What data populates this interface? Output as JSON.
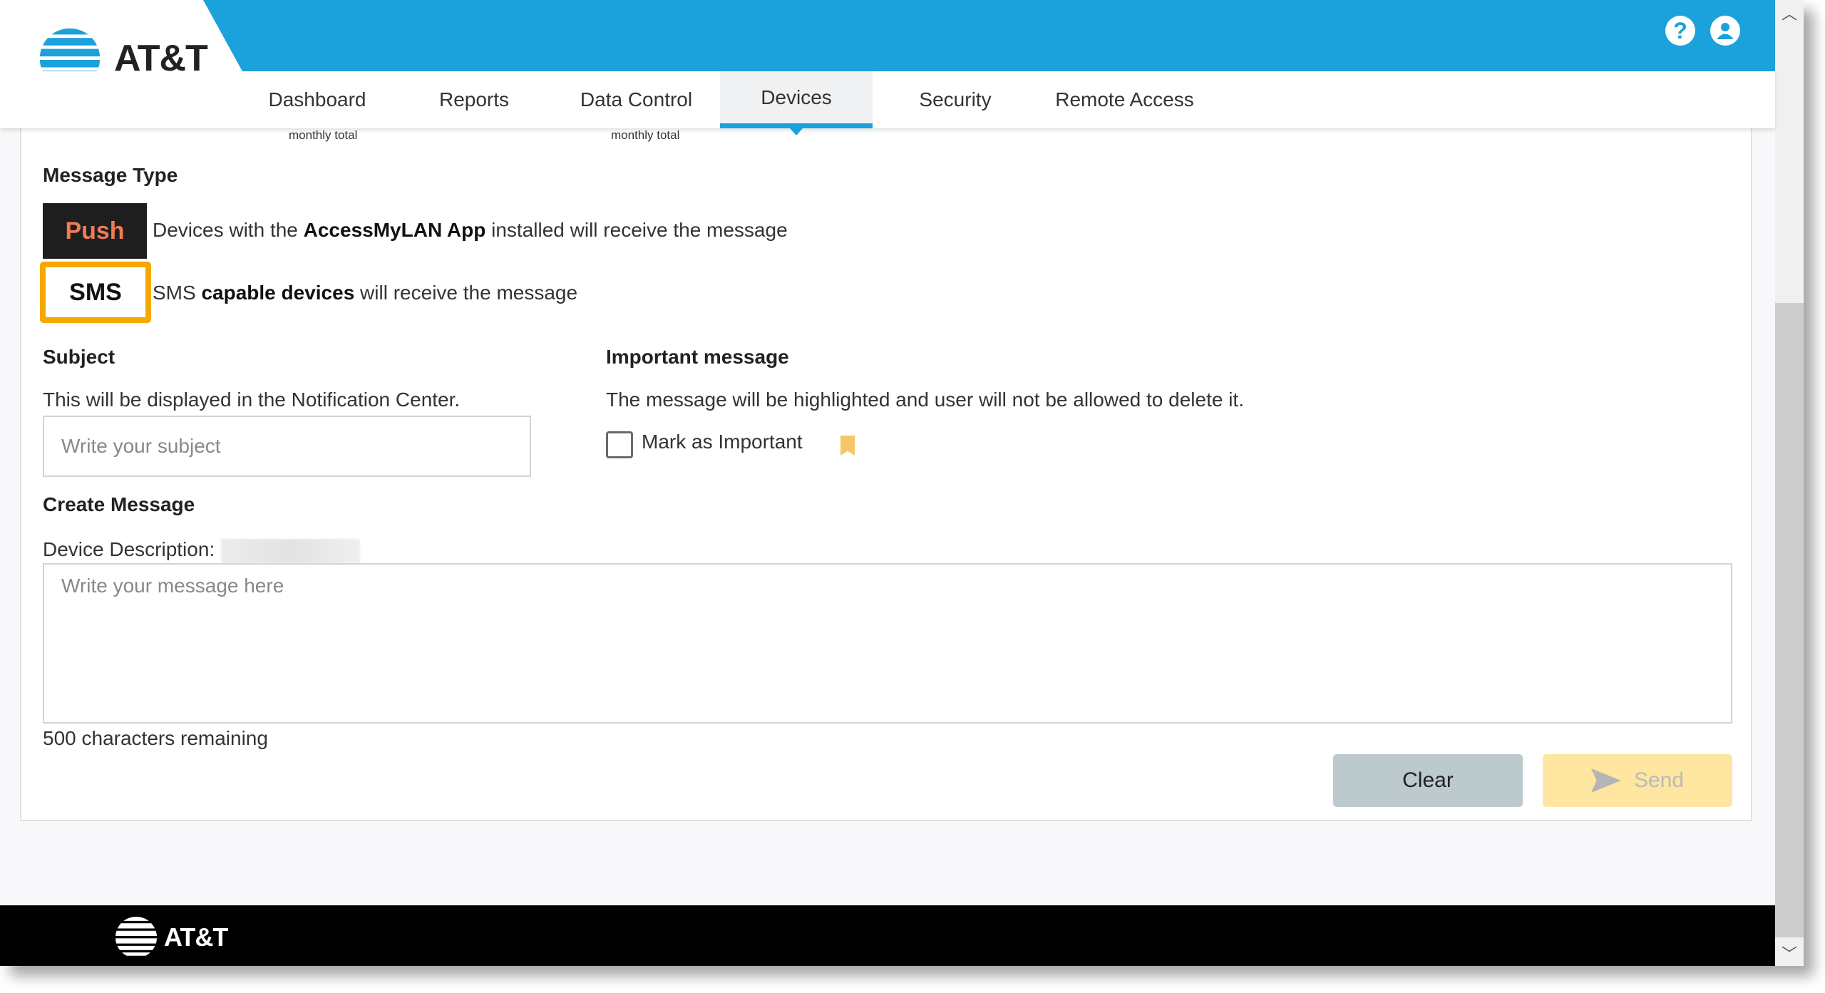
{
  "header": {
    "brand": "AT&T",
    "help_icon": "question-circle-icon",
    "user_icon": "user-circle-icon",
    "help_glyph": "?",
    "user_glyph": "👤"
  },
  "nav": {
    "tabs": [
      {
        "label": "Dashboard",
        "active": false
      },
      {
        "label": "Reports",
        "active": false
      },
      {
        "label": "Data Control",
        "active": false
      },
      {
        "label": "Devices",
        "active": true
      },
      {
        "label": "Security",
        "active": false
      },
      {
        "label": "Remote Access",
        "active": false
      }
    ],
    "accent_color": "#1ba1dc"
  },
  "summary_labels": [
    "monthly total",
    "monthly total"
  ],
  "message_type": {
    "title": "Message Type",
    "options": [
      {
        "label": "Push",
        "desc_pre": "Devices with the ",
        "desc_bold": "AccessMyLAN App",
        "desc_post": " installed will receive the message",
        "selected": false
      },
      {
        "label": "SMS",
        "desc_pre": "SMS ",
        "desc_bold": "capable devices",
        "desc_post": " will receive the message",
        "selected": true
      }
    ]
  },
  "subject": {
    "title": "Subject",
    "help": "This will be displayed in the Notification Center.",
    "placeholder": "Write your subject",
    "value": ""
  },
  "important": {
    "title": "Important message",
    "help": "The message will be highlighted and user will not be allowed to delete it.",
    "checkbox_label": "Mark as Important",
    "checked": false,
    "icon": "bookmark-icon"
  },
  "create_message": {
    "title": "Create Message",
    "device_description_label": "Device Description:",
    "placeholder": "Write your message here",
    "value": "",
    "chars_remaining": "500 characters remaining"
  },
  "actions": {
    "clear_label": "Clear",
    "send_label": "Send",
    "send_enabled": false
  },
  "footer": {
    "brand": "AT&T"
  },
  "scrollbar": {
    "up_glyph": "︿",
    "down_glyph": "﹀"
  }
}
